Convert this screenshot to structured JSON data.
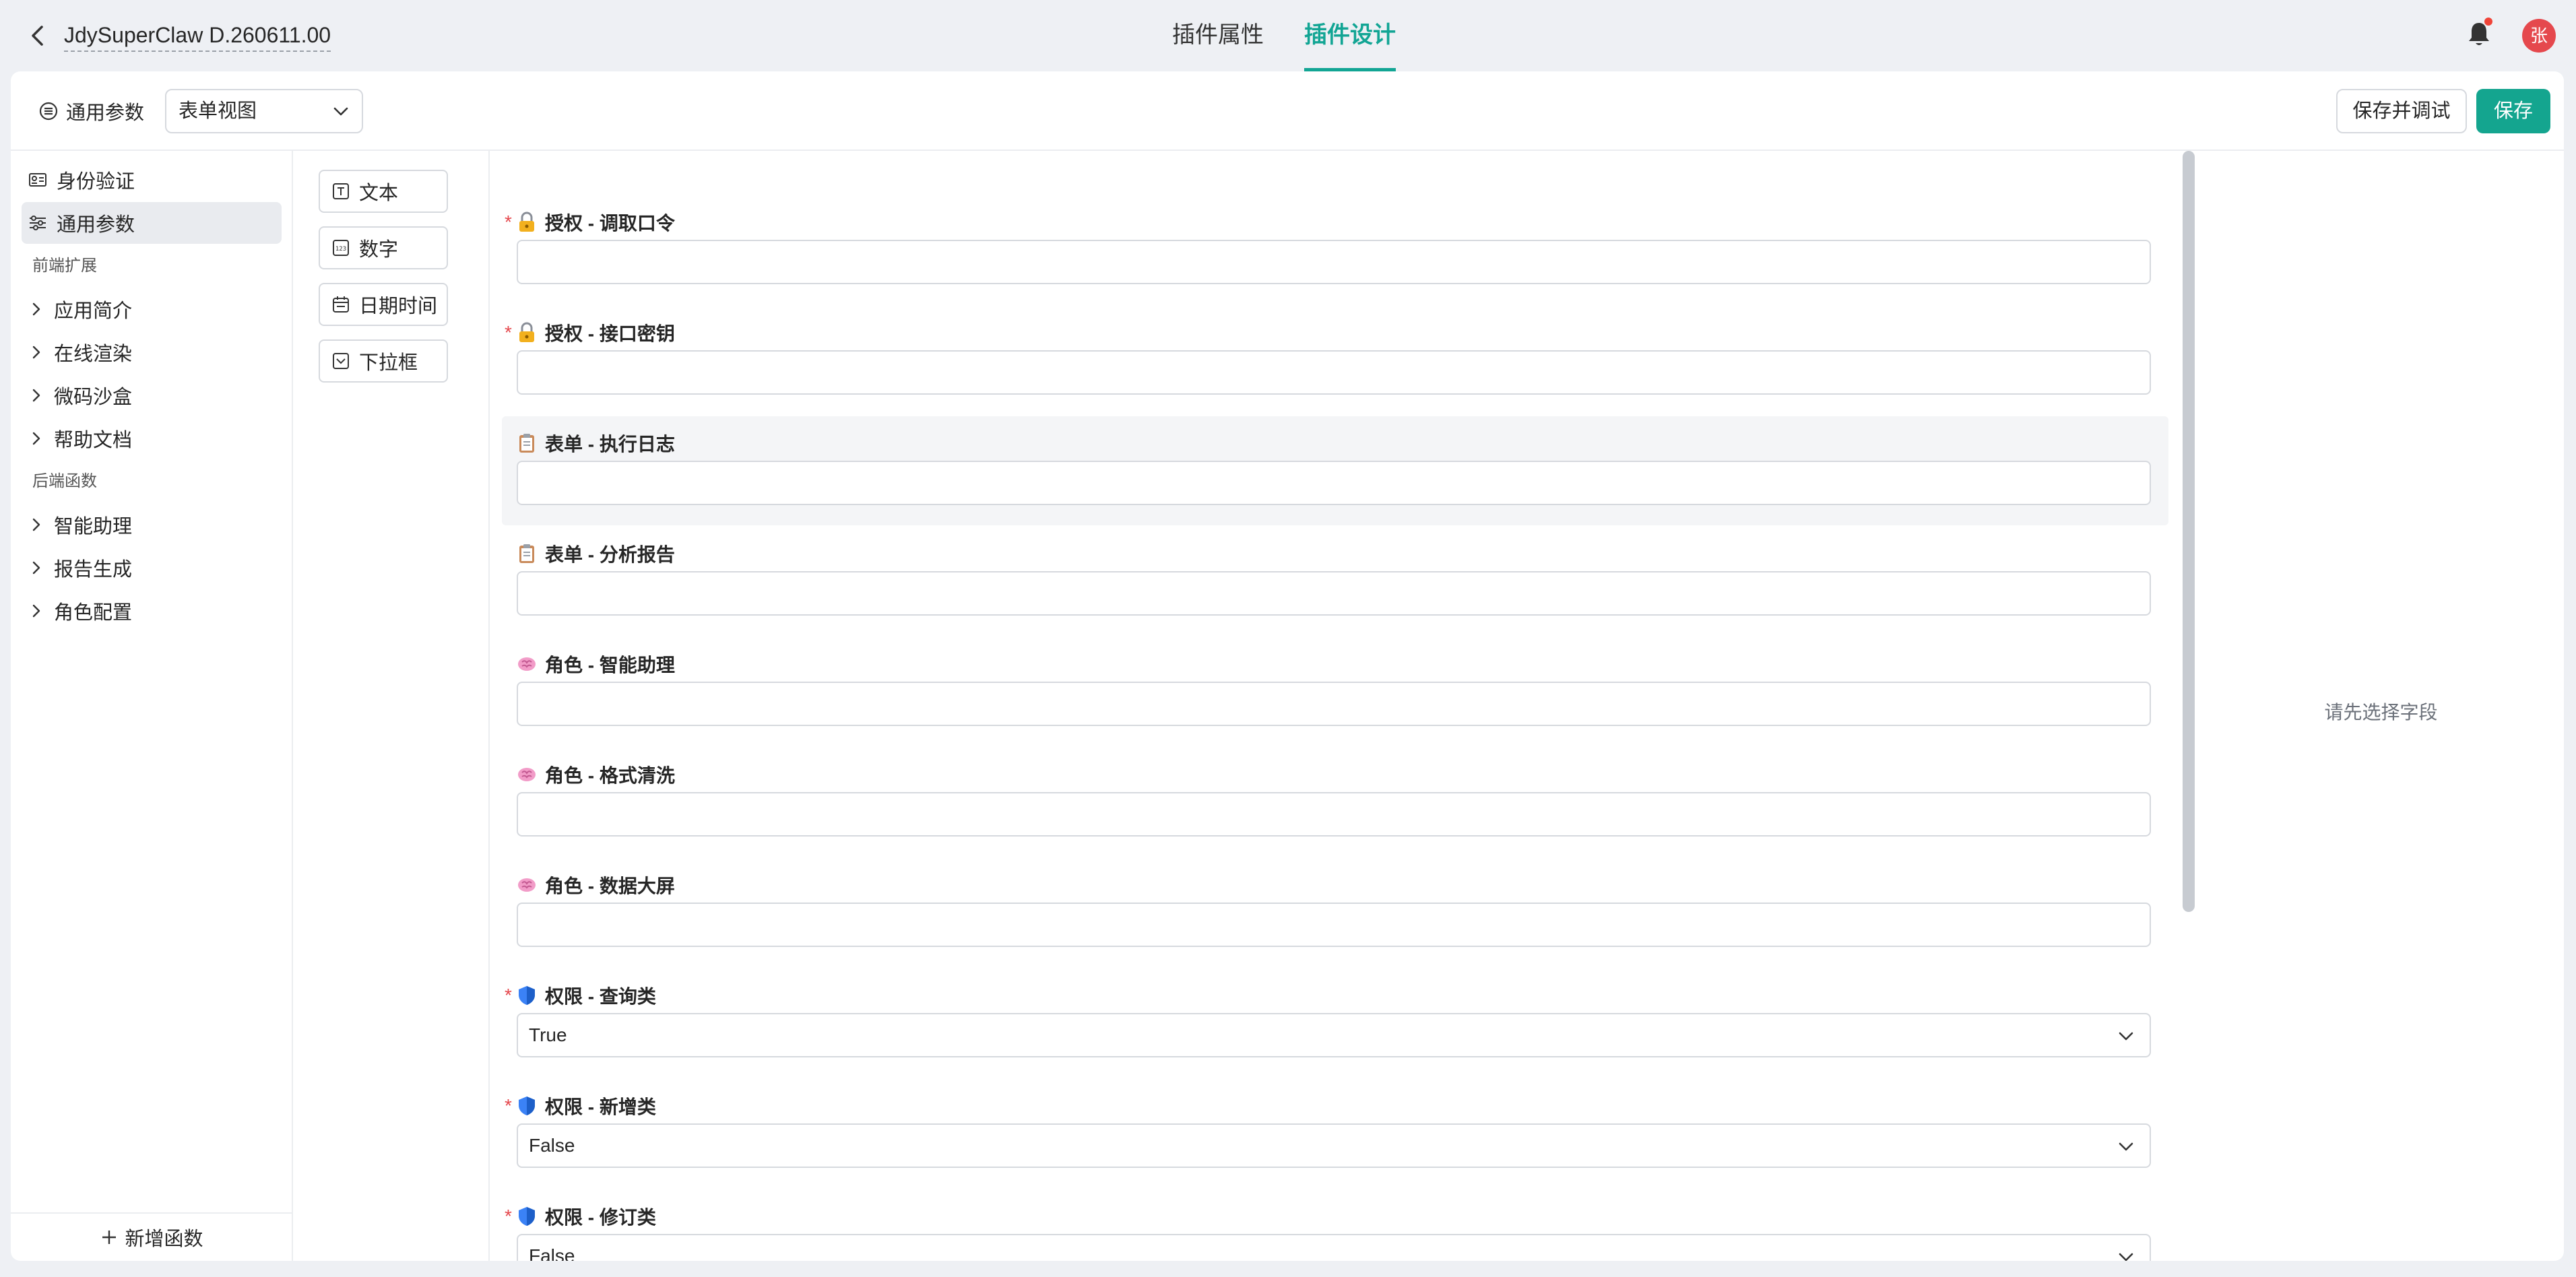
{
  "header": {
    "title": "JdySuperClaw D.260611.00",
    "tabs": [
      {
        "label": "插件属性",
        "active": false
      },
      {
        "label": "插件设计",
        "active": true
      }
    ],
    "avatar_text": "张",
    "accent_color": "#12a594"
  },
  "toolbar": {
    "param_label": "通用参数",
    "view_select": "表单视图",
    "debug_button": "保存并调试",
    "save_button": "保存"
  },
  "sidebar": {
    "items": [
      {
        "label": "身份验证",
        "icon": "id-card-icon"
      },
      {
        "label": "通用参数",
        "icon": "sliders-icon",
        "active": true
      }
    ],
    "group_frontend": "前端扩展",
    "frontend_items": [
      {
        "label": "应用简介"
      },
      {
        "label": "在线渲染"
      },
      {
        "label": "微码沙盒"
      },
      {
        "label": "帮助文档"
      }
    ],
    "group_backend": "后端函数",
    "backend_items": [
      {
        "label": "智能助理"
      },
      {
        "label": "报告生成"
      },
      {
        "label": "角色配置"
      }
    ],
    "add_function": "新增函数"
  },
  "palette": {
    "items": [
      {
        "label": "文本",
        "icon": "text-field-icon"
      },
      {
        "label": "数字",
        "icon": "number-field-icon"
      },
      {
        "label": "日期时间",
        "icon": "calendar-icon"
      },
      {
        "label": "下拉框",
        "icon": "dropdown-icon"
      }
    ]
  },
  "form": {
    "fields": [
      {
        "label": "授权 - 调取口令",
        "required": true,
        "icon": "lock-icon",
        "type": "input",
        "value": ""
      },
      {
        "label": "授权 - 接口密钥",
        "required": true,
        "icon": "lock-icon",
        "type": "input",
        "value": ""
      },
      {
        "label": "表单 - 执行日志",
        "required": false,
        "icon": "clipboard-icon",
        "type": "input",
        "value": ""
      },
      {
        "label": "表单 - 分析报告",
        "required": false,
        "icon": "clipboard-icon",
        "type": "input",
        "value": ""
      },
      {
        "label": "角色 - 智能助理",
        "required": false,
        "icon": "brain-icon",
        "type": "input",
        "value": ""
      },
      {
        "label": "角色 - 格式清洗",
        "required": false,
        "icon": "brain-icon",
        "type": "input",
        "value": ""
      },
      {
        "label": "角色 - 数据大屏",
        "required": false,
        "icon": "brain-icon",
        "type": "input",
        "value": ""
      },
      {
        "label": "权限 - 查询类",
        "required": true,
        "icon": "shield-icon",
        "type": "select",
        "value": "True"
      },
      {
        "label": "权限 - 新增类",
        "required": true,
        "icon": "shield-icon",
        "type": "select",
        "value": "False"
      },
      {
        "label": "权限 - 修订类",
        "required": true,
        "icon": "shield-icon",
        "type": "select",
        "value": "False"
      }
    ]
  },
  "props": {
    "hint": "请先选择字段"
  }
}
